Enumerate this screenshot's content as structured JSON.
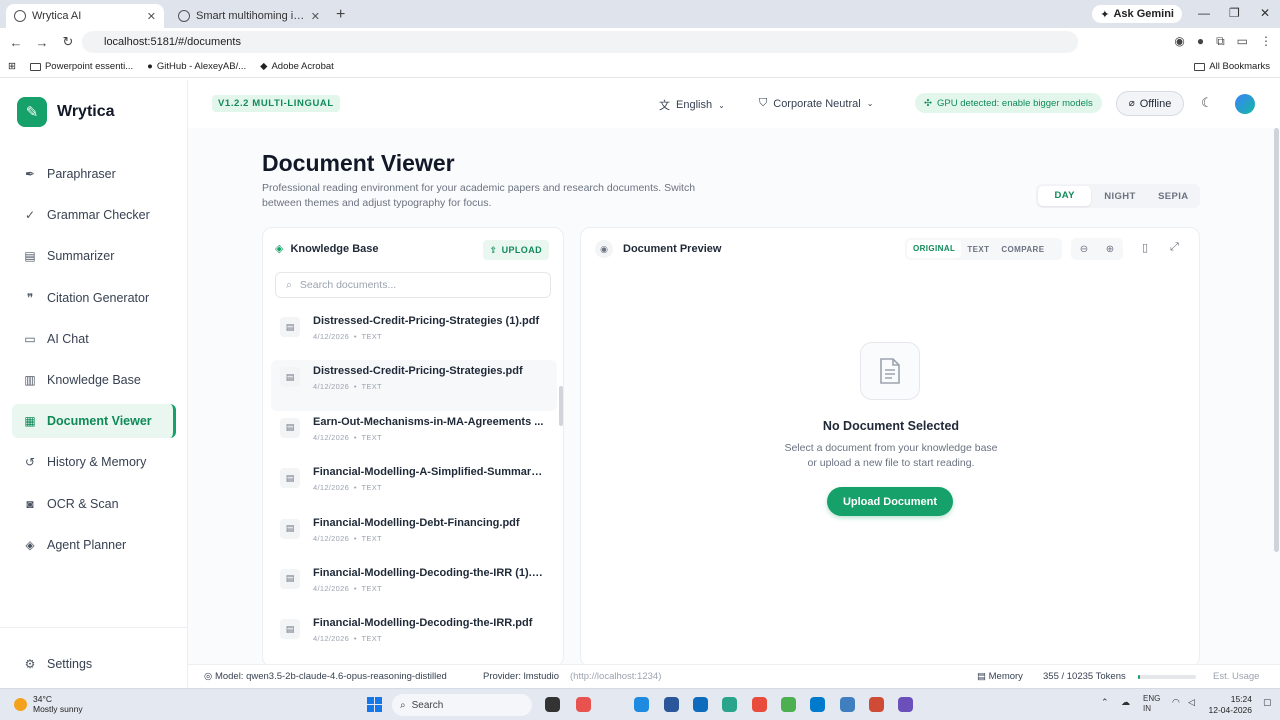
{
  "browser": {
    "tabs": [
      {
        "title": "Wrytica AI",
        "active": true
      },
      {
        "title": "Smart multihoming in smart sh",
        "active": false
      }
    ],
    "ask_gemini": "Ask Gemini",
    "url": "localhost:5181/#/documents",
    "bookmarks": [
      "Powerpoint essenti...",
      "GitHub - AlexeyAB/...",
      "Adobe Acrobat"
    ],
    "all_bookmarks": "All Bookmarks"
  },
  "app": {
    "brand": "Wrytica",
    "version": "V1.2.2 MULTI-LINGUAL",
    "language": "English",
    "tone": "Corporate Neutral",
    "gpu_notice": "GPU detected: enable bigger models",
    "status": "Offline",
    "nav": [
      {
        "label": "Paraphraser",
        "icon": "feather-icon",
        "active": false
      },
      {
        "label": "Grammar Checker",
        "icon": "check-icon",
        "active": false
      },
      {
        "label": "Summarizer",
        "icon": "file-text-icon",
        "active": false
      },
      {
        "label": "Citation Generator",
        "icon": "quote-icon",
        "active": false
      },
      {
        "label": "AI Chat",
        "icon": "chat-icon",
        "active": false
      },
      {
        "label": "Knowledge Base",
        "icon": "book-icon",
        "active": false
      },
      {
        "label": "Document Viewer",
        "icon": "document-icon",
        "active": true
      },
      {
        "label": "History & Memory",
        "icon": "history-icon",
        "active": false
      },
      {
        "label": "OCR & Scan",
        "icon": "camera-icon",
        "active": false
      },
      {
        "label": "Agent Planner",
        "icon": "bot-icon",
        "active": false
      }
    ],
    "settings": "Settings"
  },
  "page": {
    "title": "Document Viewer",
    "subtitle": "Professional reading environment for your academic papers and research documents. Switch between themes and adjust typography for focus.",
    "themes": [
      "DAY",
      "NIGHT",
      "SEPIA"
    ],
    "active_theme": "DAY"
  },
  "knowledge_base": {
    "title": "Knowledge Base",
    "upload_label": "UPLOAD",
    "search_placeholder": "Search documents...",
    "documents": [
      {
        "name": "Distressed-Credit-Pricing-Strategies (1).pdf",
        "date": "4/12/2026",
        "type": "TEXT"
      },
      {
        "name": "Distressed-Credit-Pricing-Strategies.pdf",
        "date": "4/12/2026",
        "type": "TEXT"
      },
      {
        "name": "Earn-Out-Mechanisms-in-MA-Agreements ...",
        "date": "4/12/2026",
        "type": "TEXT"
      },
      {
        "name": "Financial-Modelling-A-Simplified-Summary...",
        "date": "4/12/2026",
        "type": "TEXT"
      },
      {
        "name": "Financial-Modelling-Debt-Financing.pdf",
        "date": "4/12/2026",
        "type": "TEXT"
      },
      {
        "name": "Financial-Modelling-Decoding-the-IRR (1).pdf",
        "date": "4/12/2026",
        "type": "TEXT"
      },
      {
        "name": "Financial-Modelling-Decoding-the-IRR.pdf",
        "date": "4/12/2026",
        "type": "TEXT"
      }
    ]
  },
  "preview": {
    "title": "Document Preview",
    "modes": [
      "ORIGINAL",
      "TEXT",
      "COMPARE"
    ],
    "active_mode": "ORIGINAL",
    "empty_title": "No Document Selected",
    "empty_line1": "Select a document from your knowledge base",
    "empty_line2": "or upload a new file to start reading.",
    "upload_button": "Upload Document"
  },
  "statusbar": {
    "model": "Model: qwen3.5-2b-claude-4.6-opus-reasoning-distilled",
    "provider": "Provider: lmstudio",
    "endpoint": "(http://localhost:1234)",
    "memory": "Memory",
    "tokens": "355 / 10235 Tokens",
    "token_fraction": 0.035,
    "est_usage": "Est. Usage"
  },
  "taskbar": {
    "temperature": "34°C",
    "weather": "Mostly sunny",
    "search": "Search",
    "lang1": "ENG",
    "lang2": "IN",
    "time": "15:24",
    "date": "12-04-2026"
  },
  "colors": {
    "accent": "#16a06a",
    "accent_bg": "#e9f7f0"
  }
}
